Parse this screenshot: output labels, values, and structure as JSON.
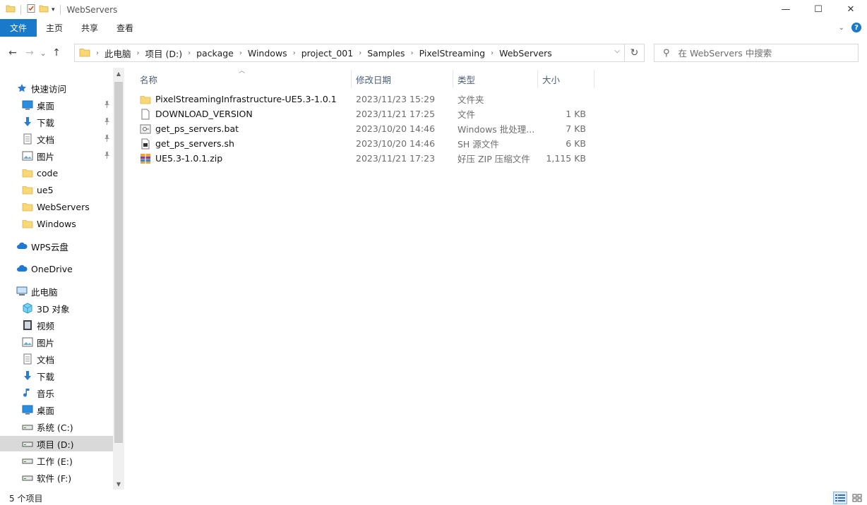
{
  "window": {
    "title": "WebServers",
    "minimize": "—",
    "maximize": "☐",
    "close": "✕"
  },
  "ribbon": {
    "tabs": [
      "文件",
      "主页",
      "共享",
      "查看"
    ]
  },
  "nav": {
    "back": "←",
    "forward": "→",
    "recent": "⌄",
    "up": "↑",
    "breadcrumb": [
      "此电脑",
      "项目 (D:)",
      "package",
      "Windows",
      "project_001",
      "Samples",
      "PixelStreaming",
      "WebServers"
    ],
    "refresh": "↻",
    "search_placeholder": "在 WebServers 中搜索"
  },
  "sidebar": {
    "items": [
      {
        "label": "快速访问",
        "icon": "star-icon",
        "level": 0,
        "pinned": false
      },
      {
        "label": "桌面",
        "icon": "desktop-icon",
        "level": 1,
        "pinned": true
      },
      {
        "label": "下载",
        "icon": "download-icon",
        "level": 1,
        "pinned": true
      },
      {
        "label": "文档",
        "icon": "document-icon",
        "level": 1,
        "pinned": true
      },
      {
        "label": "图片",
        "icon": "picture-icon",
        "level": 1,
        "pinned": true
      },
      {
        "label": "code",
        "icon": "folder-icon",
        "level": 1,
        "pinned": false
      },
      {
        "label": "ue5",
        "icon": "folder-icon",
        "level": 1,
        "pinned": false
      },
      {
        "label": "WebServers",
        "icon": "folder-icon",
        "level": 1,
        "pinned": false
      },
      {
        "label": "Windows",
        "icon": "folder-icon",
        "level": 1,
        "pinned": false
      },
      {
        "label": "WPS云盘",
        "icon": "cloud-icon",
        "level": 0,
        "pinned": false
      },
      {
        "label": "OneDrive",
        "icon": "cloud-icon",
        "level": 0,
        "pinned": false
      },
      {
        "label": "此电脑",
        "icon": "computer-icon",
        "level": 0,
        "pinned": false
      },
      {
        "label": "3D 对象",
        "icon": "cube-icon",
        "level": 1,
        "pinned": false
      },
      {
        "label": "视频",
        "icon": "video-icon",
        "level": 1,
        "pinned": false
      },
      {
        "label": "图片",
        "icon": "picture-icon",
        "level": 1,
        "pinned": false
      },
      {
        "label": "文档",
        "icon": "document-icon",
        "level": 1,
        "pinned": false
      },
      {
        "label": "下载",
        "icon": "download-icon",
        "level": 1,
        "pinned": false
      },
      {
        "label": "音乐",
        "icon": "music-icon",
        "level": 1,
        "pinned": false
      },
      {
        "label": "桌面",
        "icon": "desktop-icon",
        "level": 1,
        "pinned": false
      },
      {
        "label": "系统 (C:)",
        "icon": "drive-icon",
        "level": 1,
        "pinned": false
      },
      {
        "label": "项目 (D:)",
        "icon": "drive-icon",
        "level": 1,
        "pinned": false,
        "selected": true
      },
      {
        "label": "工作 (E:)",
        "icon": "drive-icon",
        "level": 1,
        "pinned": false
      },
      {
        "label": "软件 (F:)",
        "icon": "drive-icon",
        "level": 1,
        "pinned": false
      }
    ]
  },
  "list": {
    "columns": [
      "名称",
      "修改日期",
      "类型",
      "大小"
    ],
    "files": [
      {
        "name": "PixelStreamingInfrastructure-UE5.3-1.0.1",
        "date": "2023/11/23 15:29",
        "type": "文件夹",
        "size": "",
        "icon": "folder-icon"
      },
      {
        "name": "DOWNLOAD_VERSION",
        "date": "2023/11/21 17:25",
        "type": "文件",
        "size": "1 KB",
        "icon": "file-icon"
      },
      {
        "name": "get_ps_servers.bat",
        "date": "2023/10/20 14:46",
        "type": "Windows 批处理...",
        "size": "7 KB",
        "icon": "batch-file-icon"
      },
      {
        "name": "get_ps_servers.sh",
        "date": "2023/10/20 14:46",
        "type": "SH 源文件",
        "size": "6 KB",
        "icon": "script-file-icon"
      },
      {
        "name": "UE5.3-1.0.1.zip",
        "date": "2023/11/21 17:23",
        "type": "好压 ZIP 压缩文件",
        "size": "1,115 KB",
        "icon": "zip-archive-icon"
      }
    ]
  },
  "status": {
    "count_text": "5 个项目"
  },
  "colors": {
    "accent": "#1979ca",
    "folder": "#f8d775",
    "selected_nav": "#d9d9d9"
  }
}
